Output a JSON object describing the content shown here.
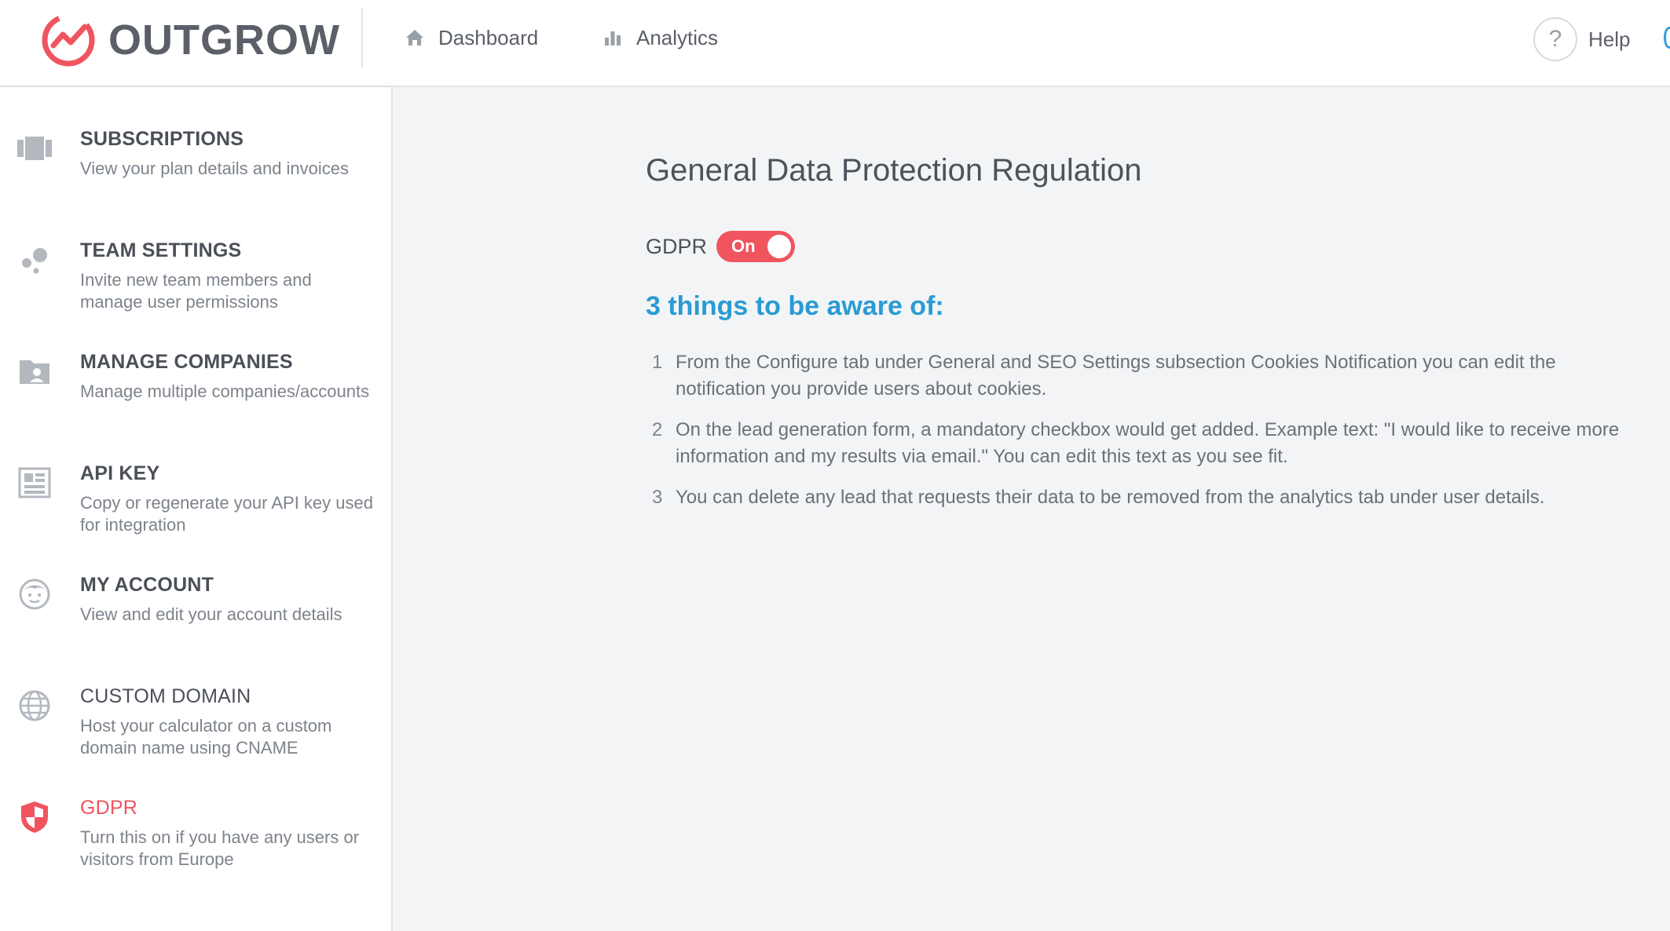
{
  "brand": {
    "name": "OUTGROW",
    "accent": "#f0545f",
    "link_blue": "#2a9bd3"
  },
  "header": {
    "nav": [
      {
        "label": "Dashboard",
        "icon": "home-icon"
      },
      {
        "label": "Analytics",
        "icon": "bar-chart-icon"
      }
    ],
    "help": {
      "label": "Help",
      "icon_glyph": "?"
    }
  },
  "sidebar": {
    "items": [
      {
        "title": "SUBSCRIPTIONS",
        "desc": "View your plan details and invoices",
        "icon": "subscriptions-icon"
      },
      {
        "title": "TEAM SETTINGS",
        "desc": "Invite new team members and manage user permissions",
        "icon": "team-icon"
      },
      {
        "title": "MANAGE COMPANIES",
        "desc": "Manage multiple companies/accounts",
        "icon": "company-folder-icon"
      },
      {
        "title": "API KEY",
        "desc": "Copy or regenerate your API key used for integration",
        "icon": "api-key-icon"
      },
      {
        "title": "MY ACCOUNT",
        "desc": "View and edit your account details",
        "icon": "user-face-icon"
      },
      {
        "title": "CUSTOM DOMAIN",
        "desc": "Host your calculator on a custom domain name using CNAME",
        "icon": "globe-icon"
      },
      {
        "title": "GDPR",
        "desc": "Turn this on if you have any users or visitors from Europe",
        "icon": "shield-icon",
        "active": true
      }
    ]
  },
  "main": {
    "title": "General Data Protection Regulation",
    "gdpr_label": "GDPR",
    "toggle_text": "On",
    "toggle_on": true,
    "aware_title": "3 things to be aware of:",
    "things": [
      {
        "num": "1",
        "text": "From the Configure tab under General and SEO Settings subsection Cookies Notification you can edit the notification you provide users about cookies."
      },
      {
        "num": "2",
        "text": "On the lead generation form, a mandatory checkbox would get added. Example text: \"I would like to receive more information and my results via email.\" You can edit this text as you see fit."
      },
      {
        "num": "3",
        "text": "You can delete any lead that requests their data to be removed from the analytics tab under user details."
      }
    ]
  }
}
